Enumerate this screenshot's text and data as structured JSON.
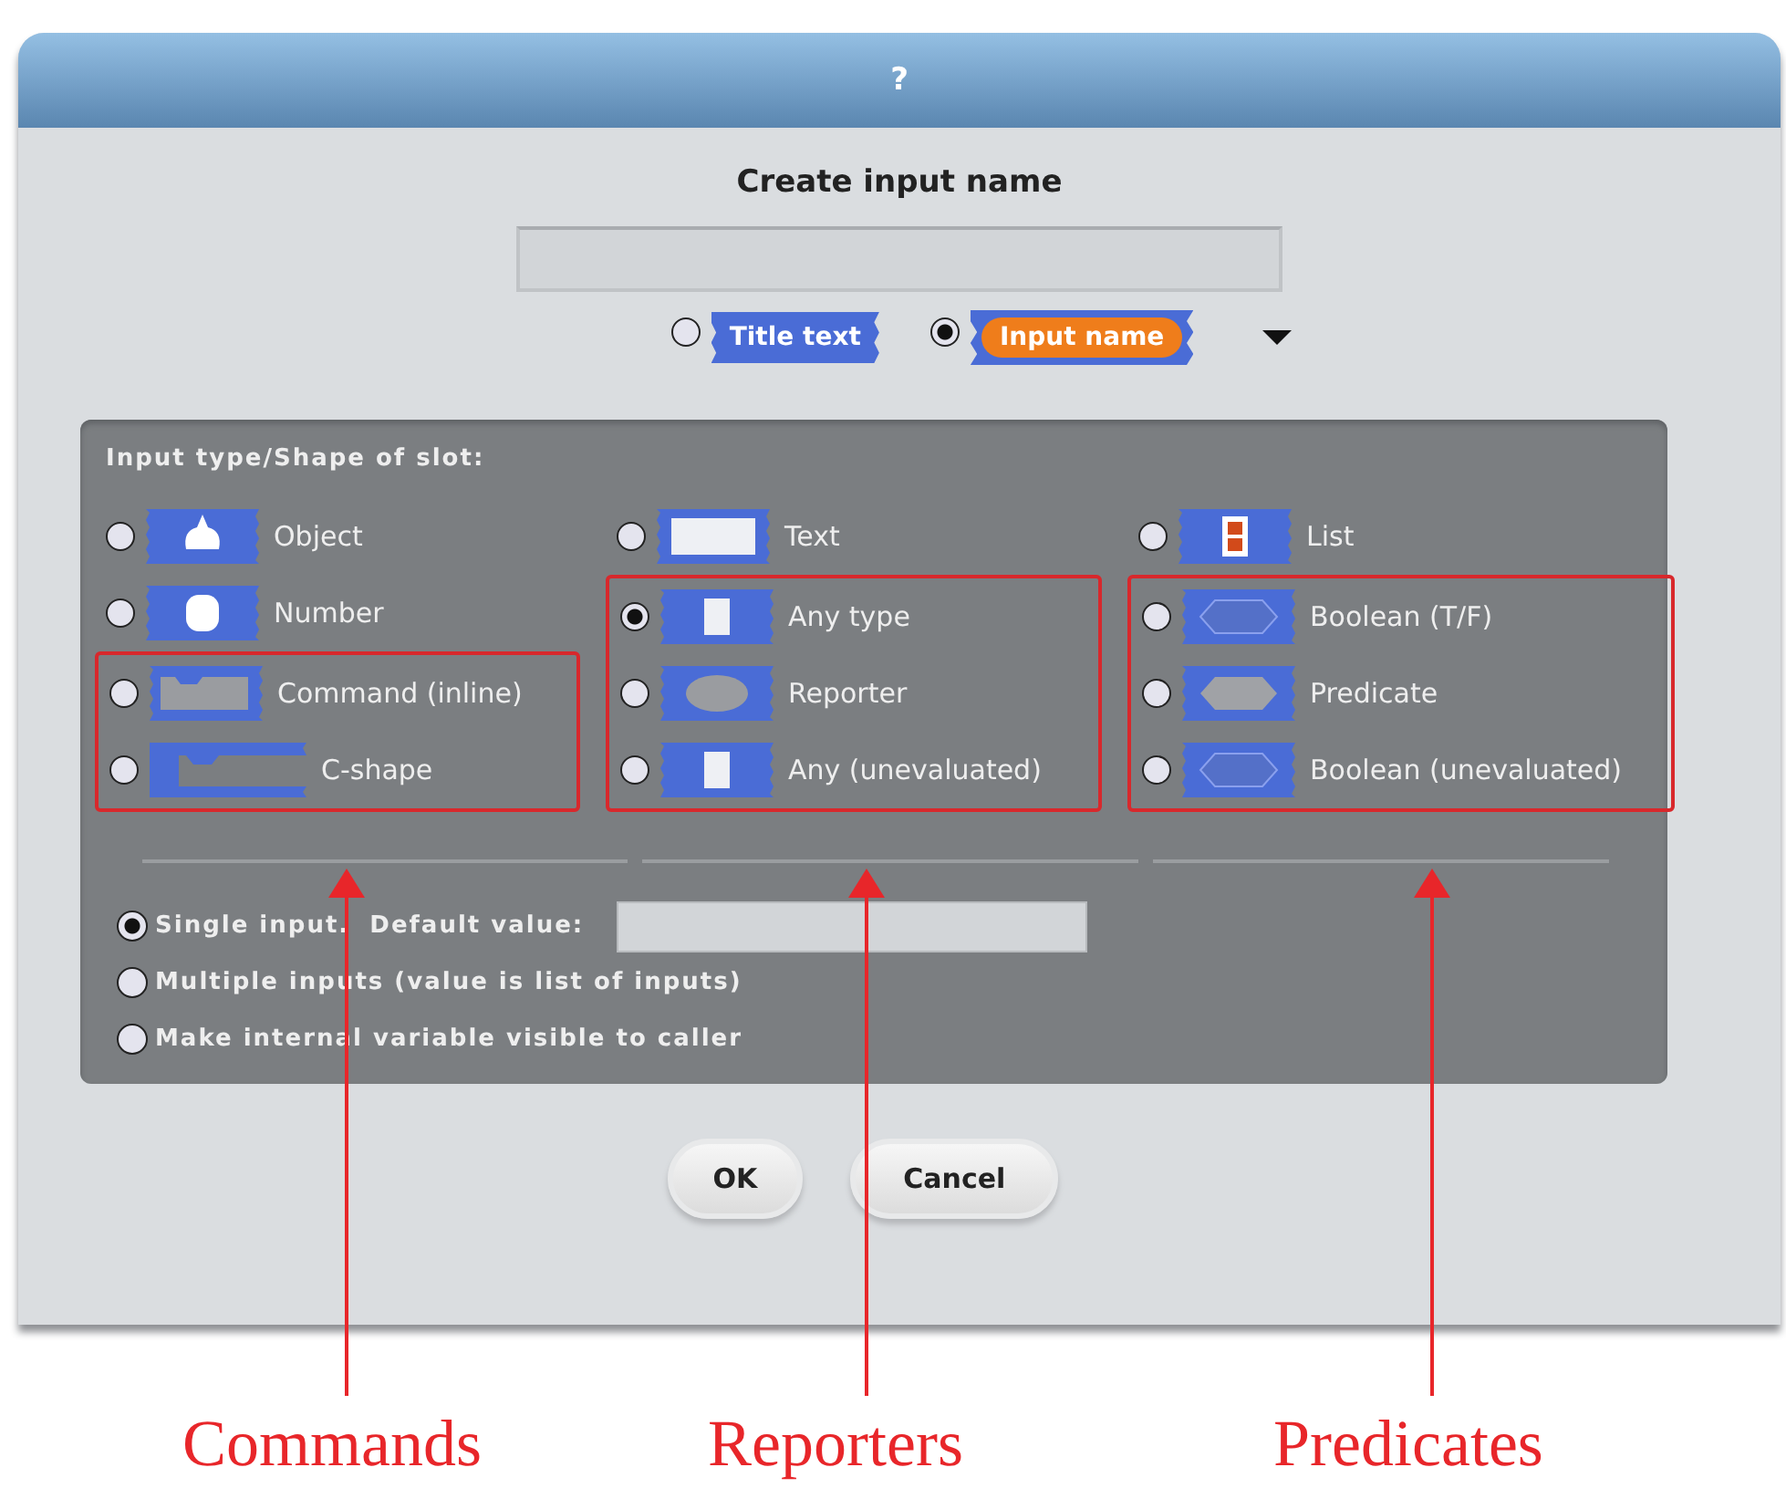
{
  "window": {
    "title": "?"
  },
  "heading": "Create input name",
  "name_kinds": [
    {
      "label": "Title text",
      "kind": "title",
      "selected": false
    },
    {
      "label": "Input name",
      "kind": "input",
      "selected": true
    }
  ],
  "slot_panel": {
    "title": "Input type/Shape of slot:",
    "columns": [
      {
        "items": [
          {
            "label": "Object",
            "kind": "object",
            "selected": false
          },
          {
            "label": "Number",
            "kind": "number",
            "selected": false
          }
        ],
        "annotated": [
          {
            "label": "Command (inline)",
            "kind": "command",
            "selected": false
          },
          {
            "label": "C-shape",
            "kind": "cshape",
            "selected": false
          }
        ]
      },
      {
        "items": [
          {
            "label": "Text",
            "kind": "text",
            "selected": false
          }
        ],
        "annotated": [
          {
            "label": "Any type",
            "kind": "any",
            "selected": true
          },
          {
            "label": "Reporter",
            "kind": "reporter",
            "selected": false
          },
          {
            "label": "Any (unevaluated)",
            "kind": "any",
            "selected": false
          }
        ]
      },
      {
        "items": [
          {
            "label": "List",
            "kind": "list",
            "selected": false
          }
        ],
        "annotated": [
          {
            "label": "Boolean (T/F)",
            "kind": "boolean",
            "selected": false
          },
          {
            "label": "Predicate",
            "kind": "predicate",
            "selected": false
          },
          {
            "label": "Boolean (unevaluated)",
            "kind": "boolean",
            "selected": false
          }
        ]
      }
    ],
    "input_modes": [
      {
        "label": "Single input.  Default value:",
        "kind": "with_field",
        "selected": true
      },
      {
        "label": "Multiple inputs (value is list of inputs)",
        "kind": "plain",
        "selected": false
      },
      {
        "label": "Make internal variable visible to caller",
        "kind": "plain",
        "selected": false
      }
    ]
  },
  "buttons": [
    "OK",
    "Cancel"
  ],
  "annotations": [
    "Commands",
    "Reporters",
    "Predicates"
  ]
}
